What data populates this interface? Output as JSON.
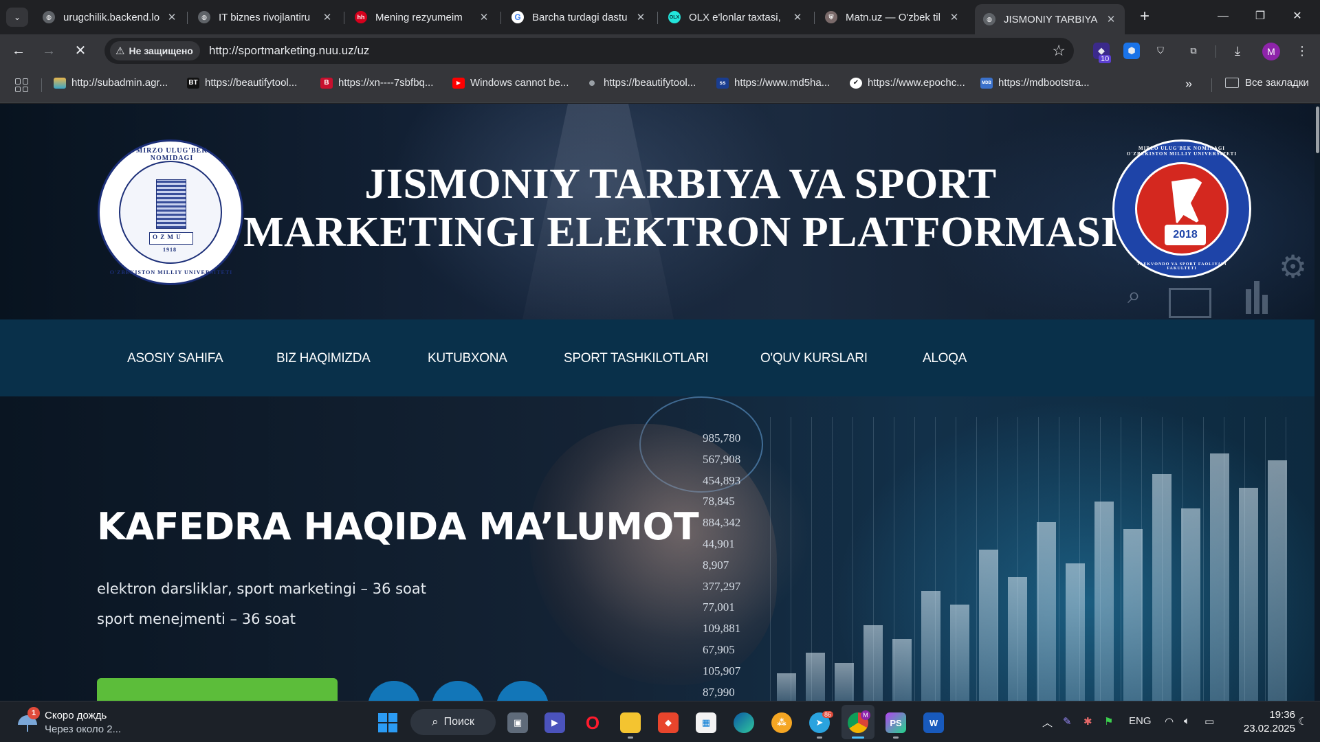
{
  "browser": {
    "tabs": [
      {
        "title": "urugchilik.backend.lo",
        "favicon": "globe-icon",
        "active": false
      },
      {
        "title": "IT biznes rivojlantiru",
        "favicon": "globe-icon",
        "active": false
      },
      {
        "title": "Mening rezyumeim",
        "favicon": "hh-icon",
        "active": false
      },
      {
        "title": "Barcha turdagi dastu",
        "favicon": "google-icon",
        "active": false
      },
      {
        "title": "OLX e'lonlar taxtasi, ",
        "favicon": "olx-icon",
        "active": false
      },
      {
        "title": "Matn.uz — O'zbek til",
        "favicon": "shield-icon",
        "active": false
      },
      {
        "title": "JISMONIY TARBIYA V",
        "favicon": "globe-icon",
        "active": true
      }
    ],
    "favicon_labels": {
      "hh": "hh",
      "olx": "OLX"
    },
    "new_tab_label": "+",
    "window_controls": {
      "minimize": "—",
      "restore": "❐",
      "close": "✕"
    },
    "security_label": "Не защищено",
    "url": "http://sportmarketing.nuu.uz/uz",
    "extension_badge": "10",
    "profile_initial": "M",
    "bookmarks": [
      {
        "label": "http://subadmin.agr...",
        "icon": "book-stack-icon"
      },
      {
        "label": "https://beautifytool...",
        "icon": "bt-icon",
        "icon_text": "BT"
      },
      {
        "label": "https://xn----7sbfbq...",
        "icon": "b-logo-icon",
        "icon_text": "B"
      },
      {
        "label": "Windows cannot be...",
        "icon": "youtube-icon",
        "icon_text": "▶"
      },
      {
        "label": "https://beautifytool...",
        "icon": "dot-icon"
      },
      {
        "label": "https://www.md5ha...",
        "icon": "hash-icon",
        "icon_text": "ss"
      },
      {
        "label": "https://www.epochc...",
        "icon": "clock-icon",
        "icon_text": "✔"
      },
      {
        "label": "https://mdbootstra...",
        "icon": "mdb-icon",
        "icon_text": "MDB"
      }
    ],
    "all_bookmarks_label": "Все закладки",
    "more_bookmarks_label": "»"
  },
  "site": {
    "left_seal": {
      "top_arc": "MIRZO ULUG'BEK NOMIDAGI",
      "bottom_arc": "O'ZBEKISTON MILLIY UNIVERSITETI",
      "plate": "O Z M U",
      "year": "1918"
    },
    "right_seal": {
      "arc": "MIRZO ULUG'BEK NOMIDAGI O'ZBEKISTON MILLIY UNIVERSITETI",
      "inner_arc": "TAEKVONDO VA SPORT FAOLIYATI FAKULTETI",
      "year": "2018"
    },
    "title_line1": "JISMONIY TARBIYA VA SPORT",
    "title_line2": "MARKETINGI ELEKTRON PLATFORMASI",
    "nav": [
      "ASOSIY SAHIFA",
      "BIZ HAQIMIZDA",
      "KUTUBXONA",
      "SPORT TASHKILOTLARI",
      "O'QUV KURSLARI",
      "ALOQA"
    ],
    "hero": {
      "title": "KAFEDRA HAQIDA MA’LUMOT",
      "line1": "elektron darsliklar, sport marketingi – 36 soat",
      "line2": "sport menejmenti – 36 soat"
    },
    "background_numbers": [
      "985,780",
      "567,908",
      "454,893",
      "78,845",
      "884,342",
      "44,901",
      "8,907",
      "377,297",
      "77,001",
      "109,881",
      "67,905",
      "105,907",
      "87,990"
    ]
  },
  "taskbar": {
    "weather_title": "Скоро дождь",
    "weather_subtitle": "Через около 2...",
    "weather_badge": "1",
    "search_label": "Поиск",
    "telegram_badge": "86",
    "chrome_profile_initial": "M",
    "word_label": "W",
    "phpstorm_label": "PS",
    "language": "ENG",
    "time": "19:36",
    "date": "23.02.2025"
  },
  "colors": {
    "nav_bar": "#09304a",
    "hero_button": "#5cbd3a",
    "social_button": "#1276b8",
    "browser_frame": "#202124",
    "toolbar": "#35363a"
  }
}
